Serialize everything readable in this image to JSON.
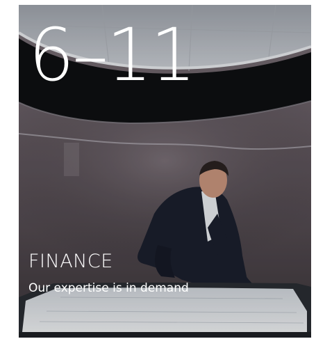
{
  "card": {
    "page_range": "6–11",
    "section_title": "FINANCE",
    "section_subtitle": "Our expertise is in demand",
    "photo": "man-at-interactive-table"
  },
  "colors": {
    "text": "#ffffff",
    "ceiling": "#c9ccd1",
    "wall": "#5e555b",
    "suit": "#1a1e2c",
    "table": "#d8dbe0"
  }
}
